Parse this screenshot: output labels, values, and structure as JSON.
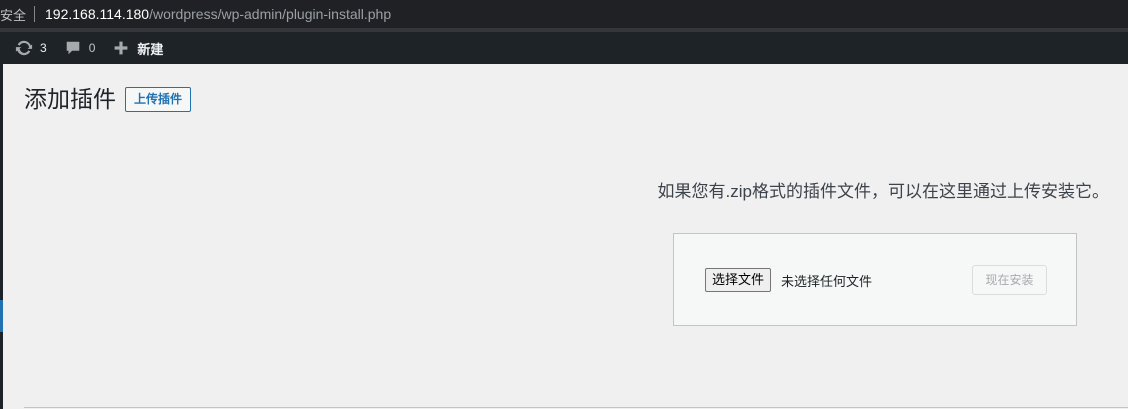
{
  "browser": {
    "security_label": "安全",
    "url_host": "192.168.114.180",
    "url_path": "/wordpress/wp-admin/plugin-install.php"
  },
  "admin_bar": {
    "updates_count": "3",
    "comments_count": "0",
    "new_label": "新建"
  },
  "page": {
    "title": "添加插件",
    "upload_toggle_label": "上传插件",
    "help_text_pre": "如果您有",
    "help_text_latin": ".zip",
    "help_text_post": "格式的插件文件，可以在这里通过上传安装它。",
    "file_button_label": "选择文件",
    "file_status": "未选择任何文件",
    "install_button_label": "现在安装"
  },
  "colors": {
    "adminbar_bg": "#1d2327",
    "page_bg": "#f0f0f1",
    "accent": "#2271b1"
  },
  "icons": {
    "updates": "refresh-icon",
    "comments": "comment-icon",
    "new": "plus-icon"
  }
}
